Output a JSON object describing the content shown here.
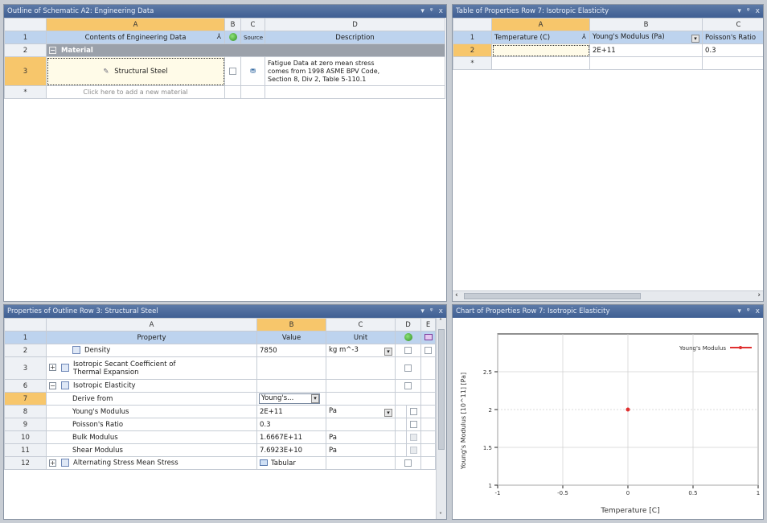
{
  "outline": {
    "title": "Outline of Schematic A2: Engineering Data",
    "col_headers": [
      "A",
      "B",
      "C",
      "D"
    ],
    "header_row": {
      "num": "1",
      "contents": "Contents of Engineering Data",
      "source": "Source",
      "description": "Description"
    },
    "section": {
      "num": "2",
      "label": "Material"
    },
    "material": {
      "num": "3",
      "name": "Structural Steel",
      "description_lines": [
        "Fatigue Data at zero mean stress",
        "comes from 1998 ASME BPV Code,",
        "Section 8, Div 2, Table 5-110.1"
      ]
    },
    "add_row": {
      "num": "*",
      "hint": "Click here to add a new material"
    }
  },
  "table": {
    "title": "Table of Properties Row 7: Isotropic Elasticity",
    "col_headers": [
      "A",
      "B",
      "C"
    ],
    "header_row": {
      "num": "1",
      "col_a": "Temperature (C)",
      "col_b": "Young's Modulus (Pa)",
      "col_c": "Poisson's Ratio"
    },
    "data_row": {
      "num": "2",
      "temperature": "",
      "youngs": "2E+11",
      "poisson": "0.3"
    },
    "add_row": {
      "num": "*"
    }
  },
  "properties": {
    "title": "Properties of Outline Row 3: Structural Steel",
    "col_headers": [
      "A",
      "B",
      "C",
      "D",
      "E"
    ],
    "header_row": {
      "num": "1",
      "property": "Property",
      "value": "Value",
      "unit": "Unit"
    },
    "rows": [
      {
        "num": "2",
        "property": "Density",
        "value": "7850",
        "unit": "kg m^-3"
      },
      {
        "num": "3",
        "property_lines": [
          "Isotropic Secant Coefficient of",
          "Thermal Expansion"
        ]
      },
      {
        "num": "6",
        "property": "Isotropic Elasticity"
      },
      {
        "num": "7",
        "property": "Derive from",
        "value": "Young's..."
      },
      {
        "num": "8",
        "property": "Young's Modulus",
        "value": "2E+11",
        "unit": "Pa"
      },
      {
        "num": "9",
        "property": "Poisson's Ratio",
        "value": "0.3"
      },
      {
        "num": "10",
        "property": "Bulk Modulus",
        "value": "1.6667E+11",
        "unit": "Pa"
      },
      {
        "num": "11",
        "property": "Shear Modulus",
        "value": "7.6923E+10",
        "unit": "Pa"
      },
      {
        "num": "12",
        "property": "Alternating Stress Mean Stress",
        "value": "Tabular"
      }
    ]
  },
  "chart": {
    "title": "Chart of Properties Row 7: Isotropic Elasticity"
  },
  "chart_data": {
    "type": "scatter",
    "title": "",
    "xlabel": "Temperature [C]",
    "ylabel": "Young's Modulus [10^11] [Pa]",
    "xlim": [
      -1,
      1
    ],
    "ylim": [
      1,
      3
    ],
    "x_ticks": [
      "-1",
      "-0.5",
      "0",
      "0.5",
      "1"
    ],
    "y_ticks": [
      "1",
      "1.5",
      "2",
      "2.5"
    ],
    "series": [
      {
        "name": "Young's Modulus",
        "x": [
          0
        ],
        "y": [
          2
        ],
        "color": "#e03030"
      }
    ],
    "grid": true,
    "legend": "top-right"
  },
  "colors": {
    "title_bar": "#3f5f93",
    "selected": "#f7c66b",
    "header": "#bdd3ee",
    "section": "#9ba1aa"
  }
}
